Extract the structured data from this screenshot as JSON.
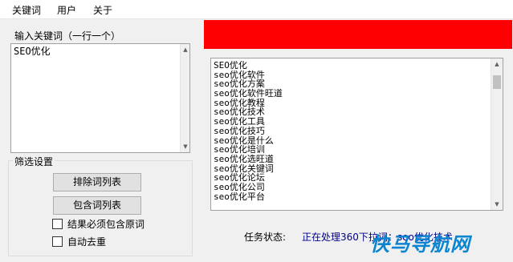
{
  "menu": {
    "items": [
      {
        "label": "关键词"
      },
      {
        "label": "用户"
      },
      {
        "label": "关于"
      }
    ]
  },
  "keyword_group": {
    "title": "输入关键词（一行一个）",
    "input_value": "SEO优化"
  },
  "filter_group": {
    "title": "筛选设置",
    "exclude_button": "排除词列表",
    "include_button": "包含词列表",
    "must_contain_label": "结果必须包含原词",
    "must_contain_checked": false,
    "dedupe_label": "自动去重",
    "dedupe_checked": false
  },
  "banner": {
    "color": "#ff0000"
  },
  "results": {
    "items": [
      "SEO优化",
      "seo优化软件",
      "seo优化方案",
      "seo优化软件旺道",
      "seo优化教程",
      "seo优化技术",
      "seo优化工具",
      "seo优化技巧",
      "seo优化是什么",
      "seo优化培训",
      "seo优化选旺道",
      "seo优化关键词",
      "seo优化论坛",
      "seo优化公司",
      "seo优化平台"
    ]
  },
  "status": {
    "label": "任务状态:",
    "text": "正在处理360下拉词：seo优化技术"
  },
  "watermark": {
    "text": "快马导航网"
  }
}
